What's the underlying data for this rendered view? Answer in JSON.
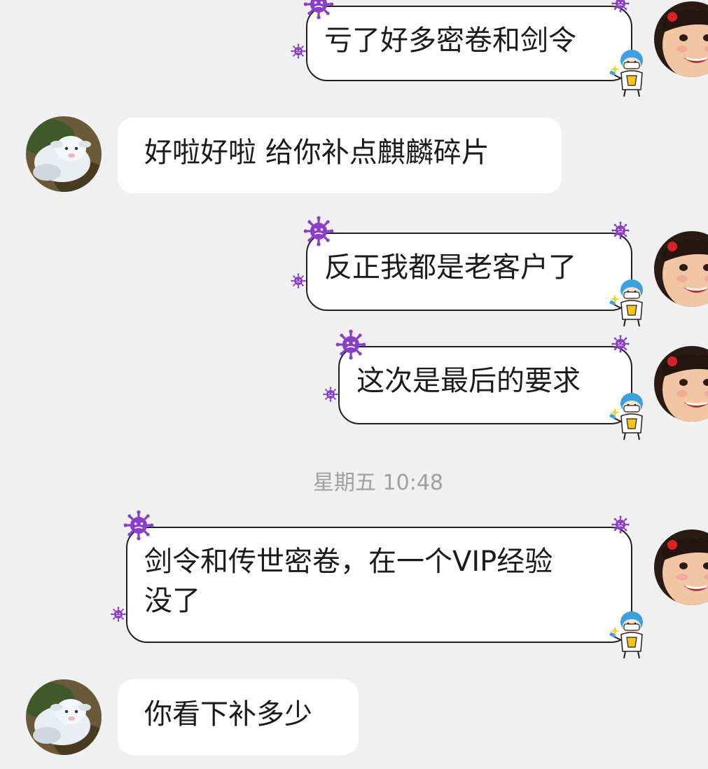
{
  "conversation": {
    "messages": [
      {
        "side": "outgoing",
        "text": "亏了好多密卷和剑令"
      },
      {
        "side": "incoming",
        "text": "好啦好啦 给你补点麒麟碎片"
      },
      {
        "side": "outgoing",
        "text": "反正我都是老客户了"
      },
      {
        "side": "outgoing",
        "text": "这次是最后的要求"
      },
      {
        "side": "outgoing",
        "text_line1": "剑令和传世密卷，在一个VIP经验",
        "text_line2": "没了"
      },
      {
        "side": "incoming",
        "text": "你看下补多少"
      }
    ],
    "timestamp": "星期五 10:48"
  },
  "colors": {
    "background": "#f0f0f0",
    "bubble": "#ffffff",
    "bubble_border": "#202020",
    "virus": "#8a3fc7",
    "timestamp": "#a0a0a0",
    "doctor_cap": "#3aa0e0"
  },
  "icons": {
    "avatar_self": "child-face-avatar",
    "avatar_other": "white-lamb-avatar",
    "bubble_decoration": [
      "purple-virus-icon",
      "doctor-sticker-icon",
      "sparkle-icon"
    ]
  }
}
